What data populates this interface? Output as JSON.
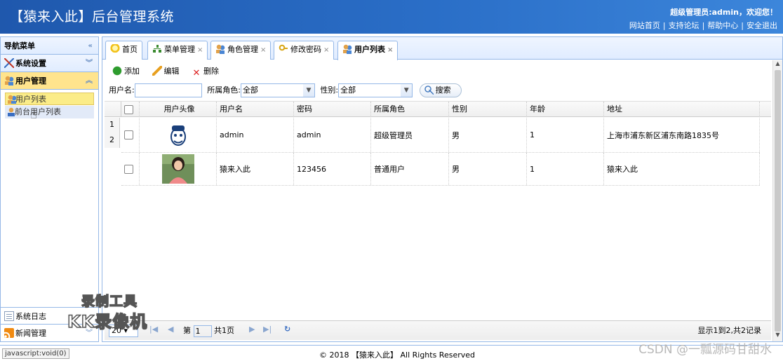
{
  "header": {
    "title": "【猿来入此】后台管理系统",
    "user_text": "超级管理员:admin，欢迎您！",
    "links": [
      "网站首页",
      "支持论坛",
      "帮助中心",
      "安全退出"
    ],
    "separator": "|"
  },
  "sidebar": {
    "title": "导航菜单",
    "sections": [
      {
        "label": "系统设置",
        "icon": "tools-icon"
      },
      {
        "label": "用户管理",
        "icon": "users-icon",
        "active": true,
        "items": [
          {
            "label": "用户列表",
            "selected": true
          },
          {
            "label": "前台用户列表"
          }
        ]
      },
      {
        "label": "系统日志",
        "icon": "log-icon"
      },
      {
        "label": "新闻管理",
        "icon": "rss-icon"
      }
    ]
  },
  "tabs": [
    {
      "label": "首页",
      "icon": "bulb-icon",
      "closable": false
    },
    {
      "label": "菜单管理",
      "icon": "tree-icon",
      "closable": true
    },
    {
      "label": "角色管理",
      "icon": "users-icon",
      "closable": true
    },
    {
      "label": "修改密码",
      "icon": "key-icon",
      "closable": true
    },
    {
      "label": "用户列表",
      "icon": "users-icon",
      "closable": true,
      "active": true
    }
  ],
  "tab_close": "×",
  "toolbar": {
    "add": "添加",
    "edit": "编辑",
    "delete": "删除"
  },
  "filters": {
    "username_label": "用户名:",
    "username_value": "",
    "role_label": "所属角色:",
    "role_value": "全部",
    "sex_label": "性别:",
    "sex_value": "全部",
    "search_button": "搜索"
  },
  "grid": {
    "columns": [
      "用户头像",
      "用户名",
      "密码",
      "所属角色",
      "性别",
      "年龄",
      "地址"
    ],
    "rows": [
      {
        "num": "1",
        "avatar": "monkey-logo",
        "username": "admin",
        "password": "admin",
        "role": "超级管理员",
        "sex": "男",
        "age": "1",
        "address": "上海市浦东新区浦东南路1835号"
      },
      {
        "num": "2",
        "avatar": "girl-photo",
        "username": "猿来入此",
        "password": "123456",
        "role": "普通用户",
        "sex": "男",
        "age": "1",
        "address": "猿来入此"
      }
    ]
  },
  "pager": {
    "page_size": "20",
    "page_label_pre": "第",
    "page_value": "1",
    "page_label_post": "共1页",
    "summary": "显示1到2,共2记录"
  },
  "watermark": {
    "line1": "录制工具",
    "line2": "KK录像机"
  },
  "status": {
    "left": "javascript:void(0)"
  },
  "footer": {
    "copyright": "© 2018 【猿来入此】 All Rights Reserved"
  },
  "csdn_watermark": "CSDN @一瓢源码甘甜水"
}
